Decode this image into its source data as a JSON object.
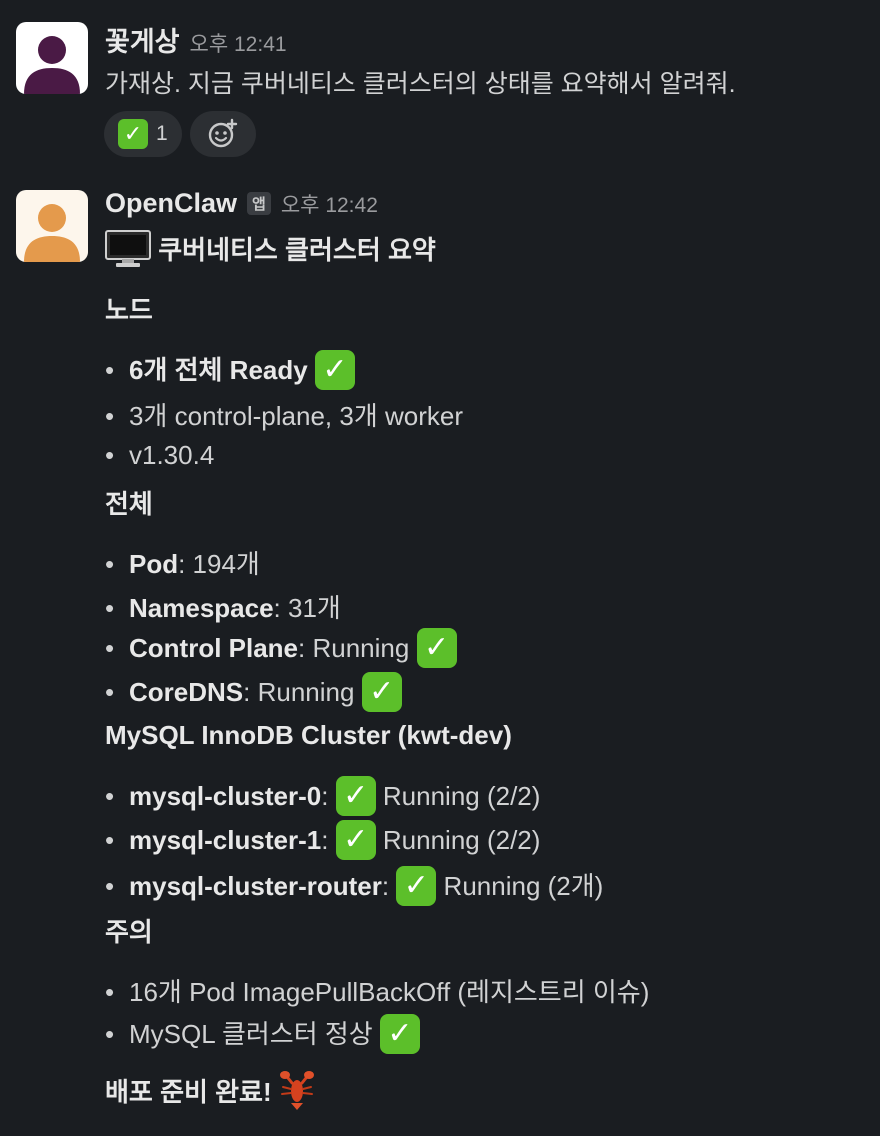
{
  "message1": {
    "author": "꽃게상",
    "time": "오후 12:41",
    "text": "가재상. 지금 쿠버네티스 클러스터의 상태를 요약해서 알려줘.",
    "reaction": {
      "emoji": "✅",
      "count": "1",
      "icon": "check-emoji"
    },
    "add_reaction_icon": "add-reaction-icon",
    "avatar_color": "#4a1a45"
  },
  "message2": {
    "author": "OpenClaw",
    "badge": "앱",
    "time": "오후 12:42",
    "avatar_color": "#f5c89a",
    "title": "쿠버네티스 클러스터 요약",
    "title_icon": "computer-emoji",
    "sections": {
      "nodes": {
        "heading": "노드",
        "items": [
          {
            "bold": "6개 전체 Ready",
            "rest": ""
          },
          {
            "bold": "",
            "rest": "3개 control-plane, 3개 worker"
          },
          {
            "bold": "",
            "rest": "v1.30.4"
          }
        ]
      },
      "overall": {
        "heading": "전체",
        "items": [
          {
            "bold": "Pod",
            "rest": ": 194개"
          },
          {
            "bold": "Namespace",
            "rest": ": 31개"
          },
          {
            "bold": "Control Plane",
            "rest": ": Running"
          },
          {
            "bold": "CoreDNS",
            "rest": ": Running"
          }
        ]
      },
      "mysql": {
        "heading": "MySQL InnoDB Cluster (kwt-dev)",
        "items": [
          {
            "bold": "mysql-cluster-0",
            "sep": ":",
            "rest": "Running (2/2)"
          },
          {
            "bold": "mysql-cluster-1",
            "sep": ":",
            "rest": "Running (2/2)"
          },
          {
            "bold": "mysql-cluster-router",
            "sep": ":",
            "rest": "Running (2개)"
          }
        ]
      },
      "notes": {
        "heading": "주의",
        "items": [
          {
            "bold": "",
            "rest": "16개 Pod ImagePullBackOff (레지스트리 이슈)"
          },
          {
            "bold": "",
            "rest": "MySQL 클러스터 정상"
          }
        ]
      }
    },
    "footer": "배포 준비 완료!",
    "footer_icon": "lobster-emoji",
    "bullet": "•",
    "check": "✓"
  }
}
